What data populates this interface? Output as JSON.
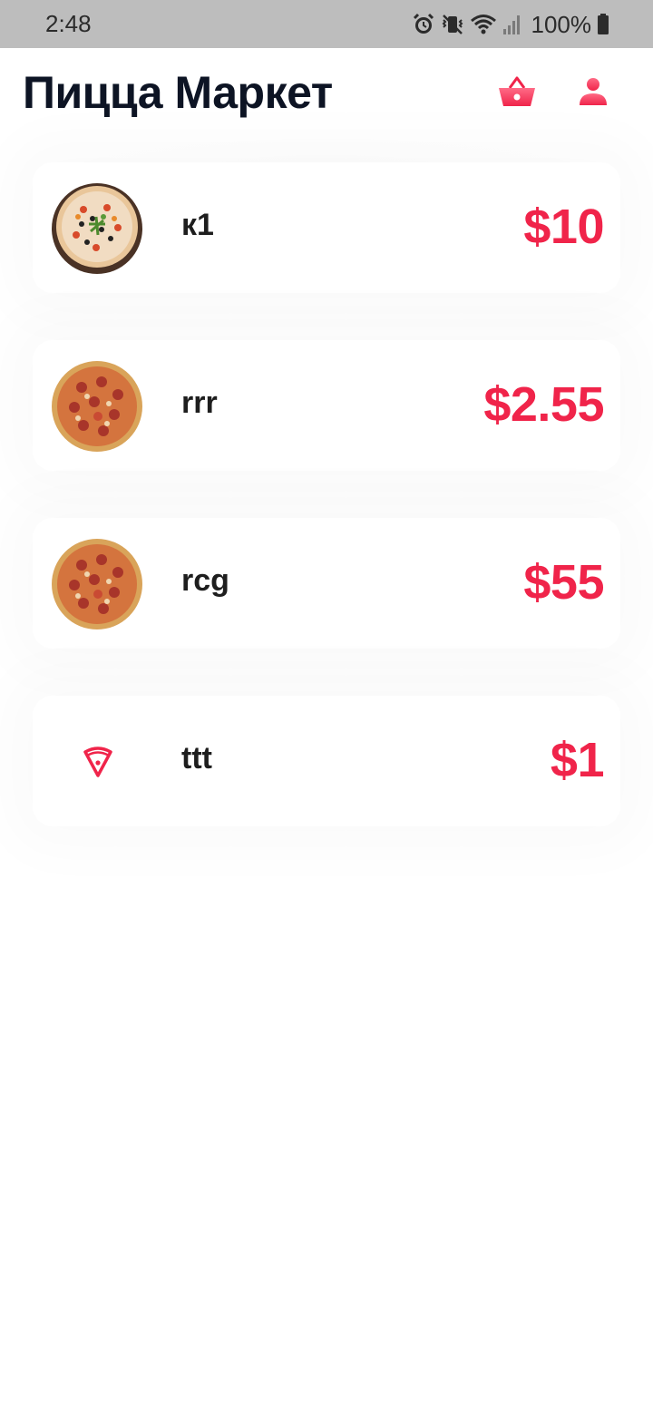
{
  "status_bar": {
    "time": "2:48",
    "battery": "100%",
    "icons": [
      "alarm-icon",
      "mute-vibrate-icon",
      "wifi-icon",
      "signal-icon",
      "battery-icon"
    ]
  },
  "header": {
    "title": "Пицца Маркет",
    "icons": [
      "basket-icon",
      "profile-icon"
    ]
  },
  "colors": {
    "accent": "#f0244a",
    "title": "#0d1424"
  },
  "items": [
    {
      "name": "к1",
      "price": "$10",
      "image": "pizza-photo-vegetable"
    },
    {
      "name": "rrr",
      "price": "$2.55",
      "image": "pizza-photo-pepperoni"
    },
    {
      "name": "rcg",
      "price": "$55",
      "image": "pizza-photo-pepperoni"
    },
    {
      "name": "ttt",
      "price": "$1",
      "image": "pizza-slice-icon"
    }
  ]
}
